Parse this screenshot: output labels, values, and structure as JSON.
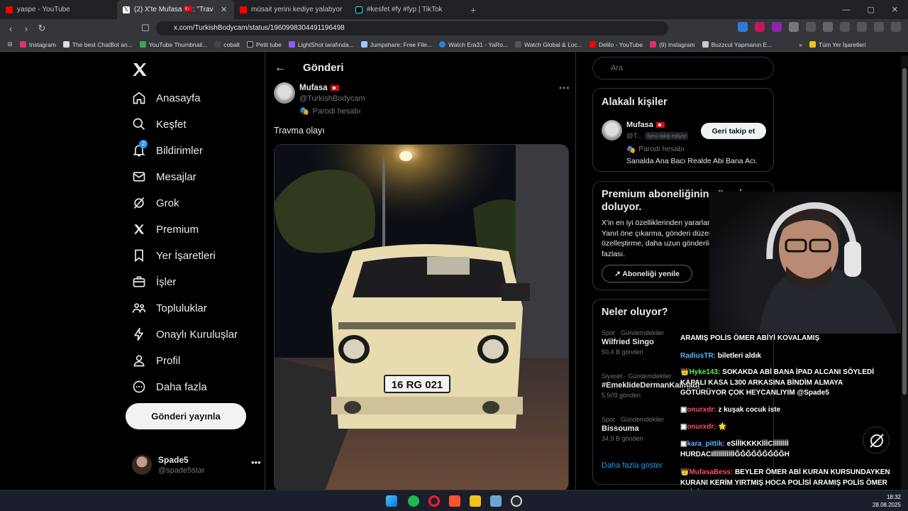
{
  "browser": {
    "tabs": [
      {
        "title": "yaspe - YouTube",
        "color": "#ff0000"
      },
      {
        "title": "(2) X'te Mufasa 🇹🇷: \"Travma olay",
        "color": "#ffffff"
      },
      {
        "title": "müsait yerini kediye yalabyor - YouTu",
        "color": "#ff0000"
      },
      {
        "title": "#kesfet #fy #fyp | TikTok",
        "color": "#25f4ee"
      }
    ],
    "url": "x.com/TurkishBodycam/status/1960998304491196498",
    "bookmarks": [
      "Instagram",
      "The best ChatBot an...",
      "YouTube Thumbnail...",
      "cobalt",
      "Petit tube",
      "LightShot tarafında...",
      "Jumpshare: Free File...",
      "Watch Era31 - YaRo...",
      "Watch Global & Loc...",
      "Delilo - YouTube",
      "(9) Instagram",
      "Buzzcut Yapmanın E...",
      "Tüm Yer İşaretleri"
    ]
  },
  "sidebar": {
    "items": [
      {
        "label": "Anasayfa",
        "icon": "home-icon"
      },
      {
        "label": "Keşfet",
        "icon": "search-icon"
      },
      {
        "label": "Bildirimler",
        "icon": "bell-icon",
        "badge": "2"
      },
      {
        "label": "Mesajlar",
        "icon": "mail-icon"
      },
      {
        "label": "Grok",
        "icon": "grok-icon"
      },
      {
        "label": "Premium",
        "icon": "x-premium-icon"
      },
      {
        "label": "Yer İşaretleri",
        "icon": "bookmark-icon"
      },
      {
        "label": "İşler",
        "icon": "briefcase-icon"
      },
      {
        "label": "Topluluklar",
        "icon": "people-icon"
      },
      {
        "label": "Onaylı Kuruluşlar",
        "icon": "lightning-icon"
      },
      {
        "label": "Profil",
        "icon": "person-icon"
      },
      {
        "label": "Daha fazla",
        "icon": "more-circle-icon"
      }
    ],
    "post_button": "Gönderi yayınla",
    "account": {
      "name": "Spade5",
      "handle": "@spade5star"
    }
  },
  "main": {
    "header_title": "Gönderi",
    "post": {
      "author_name": "Mufasa",
      "author_handle": "@TurkishBodycam",
      "parody_label": "Parodi hesabı",
      "text": "Travma olayı",
      "plate": "16 RG 021"
    }
  },
  "right": {
    "search_placeholder": "Ara",
    "related": {
      "title": "Alakalı kişiler",
      "name": "Mufasa",
      "handle": "@T...",
      "follows_you": "Seni takip ediyor",
      "parody": "Parodi hesabı",
      "bio": "Sanalda Ana Bacı Realde Abi Bana Acı.",
      "follow_button": "Geri takip et"
    },
    "premium": {
      "title": "Premium aboneliğinin süresi doluyor.",
      "body": "X'in en iyi özelliklerinden yararlanmaya devam et. Yanıt öne çıkarma, gönderi düzenleme, özelleştirme, daha uzun gönderiler ve çok daha fazlası.",
      "button": "Aboneliği yenile"
    },
    "trends": {
      "title": "Neler oluyor?",
      "items": [
        {
          "category": "Spor · Gündemdekiler",
          "name": "Wilfried Singo",
          "count": "50,4 B gönderi"
        },
        {
          "category": "Siyaset · Gündemdekiler",
          "name": "#EmeklideDermanKalmadı",
          "count": "5.509 gönderi"
        },
        {
          "category": "Spor · Gündemdekiler",
          "name": "Bissouma",
          "count": "34,9 B gönderi"
        }
      ],
      "show_more": "Daha fazla göster"
    }
  },
  "chat": [
    {
      "user": "",
      "text": "ARAMIŞ POLİS ÖMER ABİYİ KOVALAMIŞ",
      "color": "#ffffff"
    },
    {
      "user": "RadiusTR:",
      "text": "biletleri aldık",
      "color": "#5ab4ff"
    },
    {
      "user": "Hyke143:",
      "text": "SOKAKDA ABİ BANA İPAD ALCANI SÖYLEDİ KAPALI KASA L300 ARKASINA BİNDİM ALMAYA GÖTÜRÜYOR ÇOK HEYCANLIYIM @Spade5",
      "color": "#5ef05e"
    },
    {
      "user": "onurxdr:",
      "text": "z kuşak cocuk iste",
      "color": "#ff4a6a"
    },
    {
      "user": "onurxdr:",
      "text": "🌟",
      "color": "#ff4a6a"
    },
    {
      "user": "kara_pittik:",
      "text": "eSİİİKKKKİİİCİİİİİİİİ HURDACIİİİİİİİİİİİĞĞĞĞĞĞĞĞĞH",
      "color": "#5ab4ff"
    },
    {
      "user": "MufasaBess:",
      "text": "BEYLER ÖMER ABİ KURAN KURSUNDAYKEN KURANI KERİM YIRTMIŞ HOCA POLİSİ ARAMIŞ POLİS ÖMER ABİYİ KOVALAMIŞ",
      "color": "#ff4a6a"
    }
  ],
  "taskbar": {
    "time": "18:32",
    "date": "28.08.2025"
  }
}
